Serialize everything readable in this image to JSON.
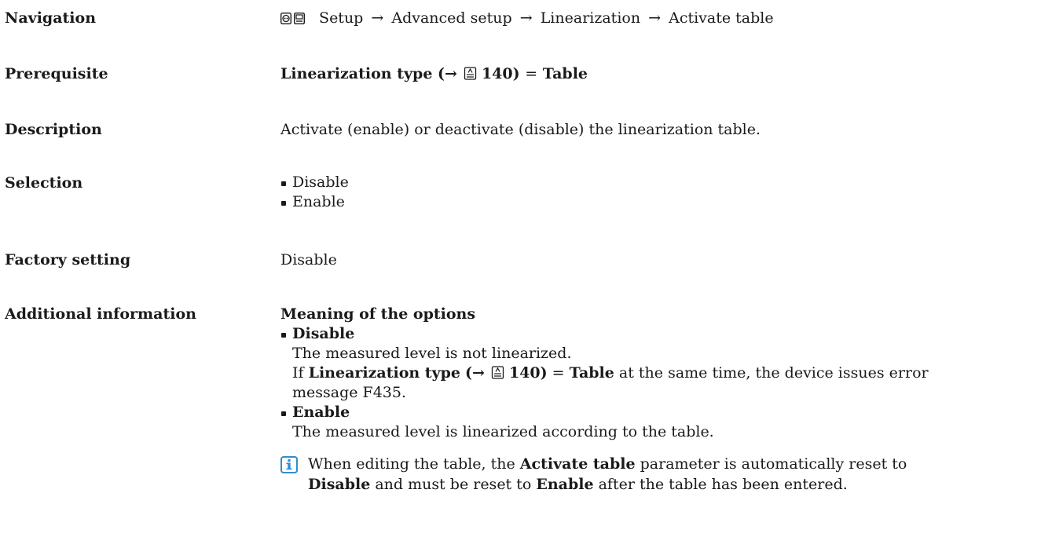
{
  "navigation": {
    "label": "Navigation",
    "icons": [
      "display-icon",
      "operating-icon"
    ],
    "steps": [
      "Setup",
      "Advanced setup",
      "Linearization",
      "Activate table"
    ],
    "arrow": "→"
  },
  "prerequisite": {
    "label": "Prerequisite",
    "parameter": "Linearization type",
    "ref_prefix": "(→",
    "ref_icon": "book-icon",
    "ref_page": "140)",
    "equals": "=",
    "value": "Table"
  },
  "description": {
    "label": "Description",
    "text": "Activate (enable) or deactivate (disable) the linearization table."
  },
  "selection": {
    "label": "Selection",
    "options": [
      "Disable",
      "Enable"
    ]
  },
  "factory_setting": {
    "label": "Factory setting",
    "value": "Disable"
  },
  "additional_information": {
    "label": "Additional information",
    "heading": "Meaning of the options",
    "disable": {
      "title": "Disable",
      "line1": "The measured level is not linearized.",
      "line2_prefix": "If",
      "line2_param": "Linearization type",
      "line2_ref_prefix": "(→",
      "line2_ref_page": "140)",
      "line2_equals": "=",
      "line2_value": "Table",
      "line2_suffix": "at the same time, the device issues error",
      "line3": "message F435."
    },
    "enable": {
      "title": "Enable",
      "line1": "The measured level is linearized according to the table."
    }
  },
  "note": {
    "icon": "info-icon",
    "icon_color": "#2f8dd1",
    "part1": "When editing the table, the",
    "param": "Activate table",
    "part2": "parameter is automatically reset to",
    "value1": "Disable",
    "part3": "and must be reset to",
    "value2": "Enable",
    "part4": "after the table has been entered."
  }
}
